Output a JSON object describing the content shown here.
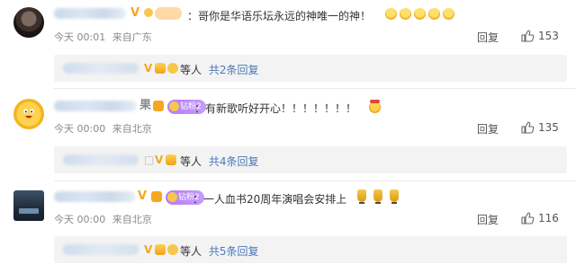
{
  "comments": [
    {
      "text": "哥你是华语乐坛永远的神唯一的神！",
      "badge": "",
      "time": "今天 00:01",
      "location": "来自广东",
      "reply_label": "回复",
      "likes": "153",
      "sub_people": "等人",
      "sub_count": "共2条回复"
    },
    {
      "text": "有新歌听好开心！！！！！！！",
      "badge": "钻粉2",
      "time": "今天 00:00",
      "location": "来自北京",
      "reply_label": "回复",
      "likes": "135",
      "sub_people": "等人",
      "sub_count": "共4条回复"
    },
    {
      "text": "一人血书20周年演唱会安排上",
      "badge": "钻粉2",
      "time": "今天 00:00",
      "location": "来自北京",
      "reply_label": "回复",
      "likes": "116",
      "sub_people": "等人",
      "sub_count": "共5条回复"
    }
  ],
  "colors": {
    "accent_link": "#4a79b8",
    "vip_gold": "#f5a623",
    "badge_purple": "#b27cf7"
  },
  "icons": {
    "like": "thumb-up-icon",
    "vip": "vip-crown-icon"
  }
}
